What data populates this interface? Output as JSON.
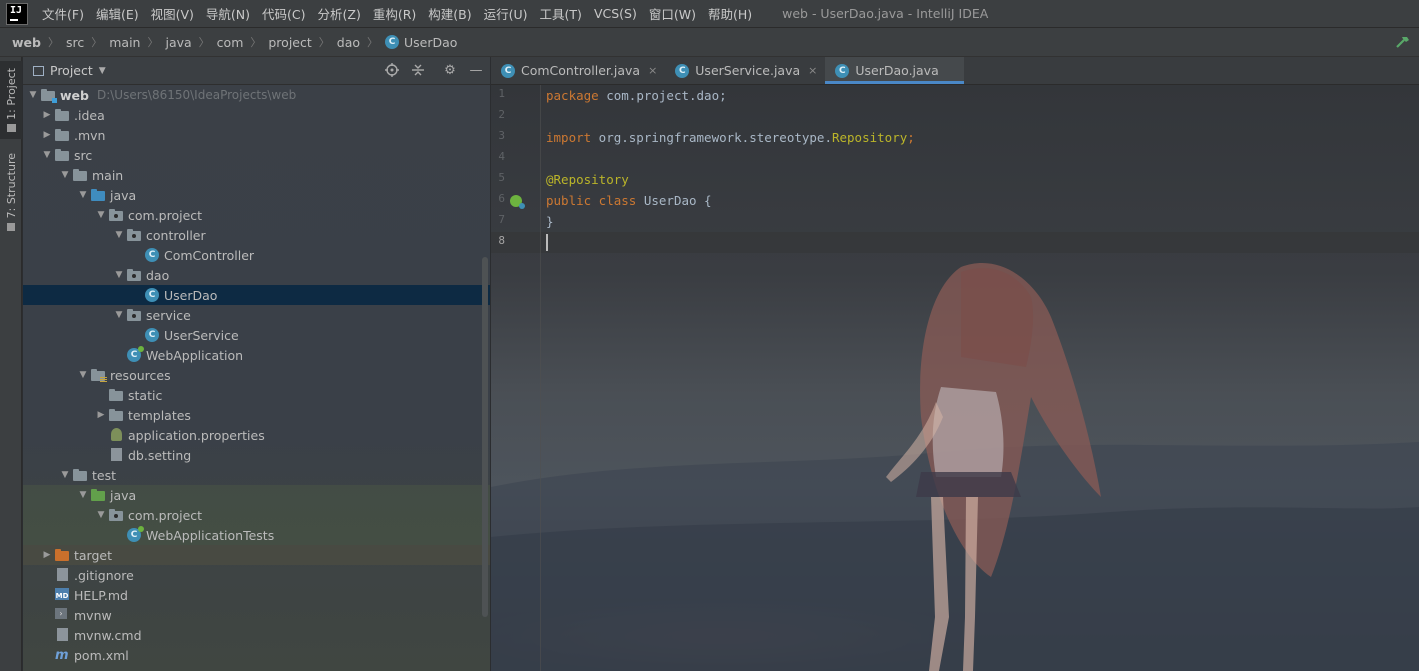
{
  "menubar": {
    "logo_text": "IJ",
    "items": [
      "文件(F)",
      "编辑(E)",
      "视图(V)",
      "导航(N)",
      "代码(C)",
      "分析(Z)",
      "重构(R)",
      "构建(B)",
      "运行(U)",
      "工具(T)",
      "VCS(S)",
      "窗口(W)",
      "帮助(H)"
    ],
    "window_title": "web - UserDao.java - IntelliJ IDEA"
  },
  "breadcrumb": [
    "web",
    "src",
    "main",
    "java",
    "com",
    "project",
    "dao",
    "UserDao"
  ],
  "toolstrip": {
    "project_tab": "1: Project",
    "structure_tab": "7: Structure"
  },
  "project_panel": {
    "title": "Project",
    "tree": [
      {
        "label": "web",
        "hint": "D:\\Users\\86150\\IdeaProjects\\web",
        "depth": 0,
        "expanded": true,
        "icon": "module-folder-icon"
      },
      {
        "label": ".idea",
        "depth": 1,
        "expanded": false,
        "icon": "folder-icon"
      },
      {
        "label": ".mvn",
        "depth": 1,
        "expanded": false,
        "icon": "folder-icon"
      },
      {
        "label": "src",
        "depth": 1,
        "expanded": true,
        "icon": "folder-icon"
      },
      {
        "label": "main",
        "depth": 2,
        "expanded": true,
        "icon": "folder-icon"
      },
      {
        "label": "java",
        "depth": 3,
        "expanded": true,
        "icon": "source-folder-icon"
      },
      {
        "label": "com.project",
        "depth": 4,
        "expanded": true,
        "icon": "package-icon"
      },
      {
        "label": "controller",
        "depth": 5,
        "expanded": true,
        "icon": "package-icon"
      },
      {
        "label": "ComController",
        "depth": 6,
        "icon": "class-icon"
      },
      {
        "label": "dao",
        "depth": 5,
        "expanded": true,
        "icon": "package-icon"
      },
      {
        "label": "UserDao",
        "depth": 6,
        "icon": "class-icon",
        "selected": true
      },
      {
        "label": "service",
        "depth": 5,
        "expanded": true,
        "icon": "package-icon"
      },
      {
        "label": "UserService",
        "depth": 6,
        "icon": "class-icon"
      },
      {
        "label": "WebApplication",
        "depth": 5,
        "icon": "spring-class-icon"
      },
      {
        "label": "resources",
        "depth": 3,
        "expanded": true,
        "icon": "resources-folder-icon"
      },
      {
        "label": "static",
        "depth": 4,
        "icon": "folder-icon"
      },
      {
        "label": "templates",
        "depth": 4,
        "expanded": false,
        "icon": "folder-icon"
      },
      {
        "label": "application.properties",
        "depth": 4,
        "icon": "properties-file-icon"
      },
      {
        "label": "db.setting",
        "depth": 4,
        "icon": "file-icon"
      },
      {
        "label": "test",
        "depth": 2,
        "expanded": true,
        "icon": "folder-icon"
      },
      {
        "label": "java",
        "depth": 3,
        "expanded": true,
        "icon": "test-source-folder-icon"
      },
      {
        "label": "com.project",
        "depth": 4,
        "expanded": true,
        "icon": "package-icon"
      },
      {
        "label": "WebApplicationTests",
        "depth": 5,
        "icon": "spring-class-icon"
      },
      {
        "label": "target",
        "depth": 1,
        "expanded": false,
        "icon": "excluded-folder-icon"
      },
      {
        "label": ".gitignore",
        "depth": 1,
        "icon": "gitignore-file-icon"
      },
      {
        "label": "HELP.md",
        "depth": 1,
        "icon": "markdown-file-icon"
      },
      {
        "label": "mvnw",
        "depth": 1,
        "icon": "shell-file-icon"
      },
      {
        "label": "mvnw.cmd",
        "depth": 1,
        "icon": "file-icon"
      },
      {
        "label": "pom.xml",
        "depth": 1,
        "icon": "maven-file-icon"
      }
    ]
  },
  "editor": {
    "tabs": [
      {
        "label": "ComController.java",
        "active": false
      },
      {
        "label": "UserService.java",
        "active": false
      },
      {
        "label": "UserDao.java",
        "active": true
      }
    ],
    "line_numbers": [
      "1",
      "2",
      "3",
      "4",
      "5",
      "6",
      "7",
      "8"
    ],
    "current_line": "8",
    "code": {
      "l1_kw": "package",
      "l1_rest": " com.project.dao;",
      "l3_kw": "import",
      "l3_rest": " org.springframework.stereotype.",
      "l3_cls": "Repository",
      "l3_end": ";",
      "l5_ann": "@Repository",
      "l6_kw": "public class",
      "l6_rest": " UserDao {",
      "l7": "}"
    }
  },
  "colors": {
    "keyword": "#cc7832",
    "annotation": "#bbb529",
    "plain": "#a9b7c6",
    "selection": "#0d2a43",
    "active_tab_underline": "#4a88c7"
  }
}
